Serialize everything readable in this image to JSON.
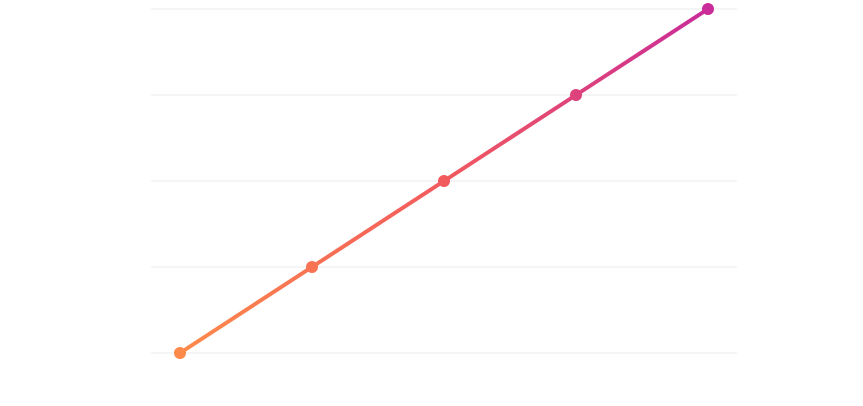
{
  "chart_data": {
    "type": "line",
    "title": "",
    "xlabel": "",
    "ylabel": "",
    "x": [
      1,
      2,
      3,
      4,
      5
    ],
    "series": [
      {
        "values": [
          0,
          1,
          2,
          3,
          4
        ]
      }
    ],
    "ylim": [
      0,
      4
    ],
    "grid": true,
    "y_grid_values": [
      0,
      1,
      2,
      3,
      4
    ],
    "show_tick_labels": false,
    "show_axes": false,
    "legend": "none"
  },
  "colors": {
    "gradient_start": "#fd8a4a",
    "gradient_mid": "#f25a5e",
    "gradient_end": "#c92b99",
    "grid": "#ebebeb",
    "background": "#ffffff"
  }
}
